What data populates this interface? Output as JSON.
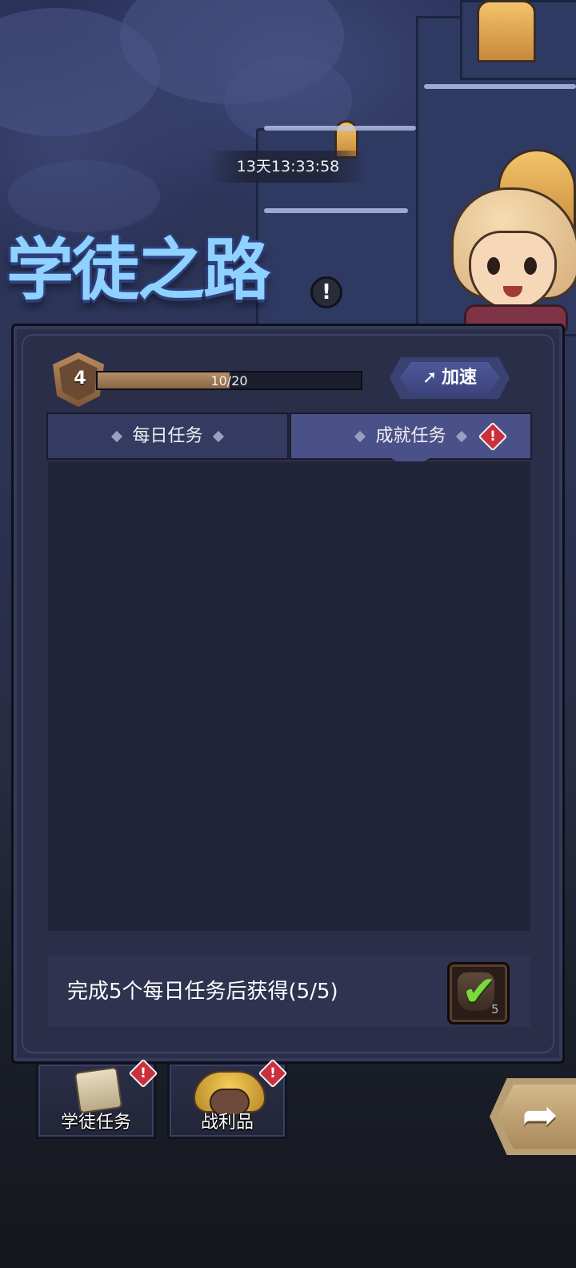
{
  "header": {
    "timer": "13天13:33:58",
    "title": "学徒之路",
    "help_icon": "!"
  },
  "level": {
    "value": "4",
    "xp_text": "10/20",
    "xp_fraction": 0.5
  },
  "speed_button": {
    "icon": "➚",
    "label": "加速"
  },
  "tabs": [
    {
      "label": "每日任务",
      "active": false
    },
    {
      "label": "成就任务",
      "active": true,
      "alert": "!"
    }
  ],
  "reward": {
    "text": "完成5个每日任务后获得(5/5)",
    "check_icon": "✔",
    "count": "5"
  },
  "shortcuts": [
    {
      "label": "学徒任务",
      "icon": "scroll-icon",
      "alert": "!"
    },
    {
      "label": "战利品",
      "icon": "treasure-icon",
      "alert": "!"
    }
  ],
  "back_button": {
    "icon": "➦"
  },
  "colors": {
    "panel": "#2b2e48",
    "tab_active": "#4a5088",
    "alert": "#c9303b",
    "xp_fill": "#b58d67"
  }
}
